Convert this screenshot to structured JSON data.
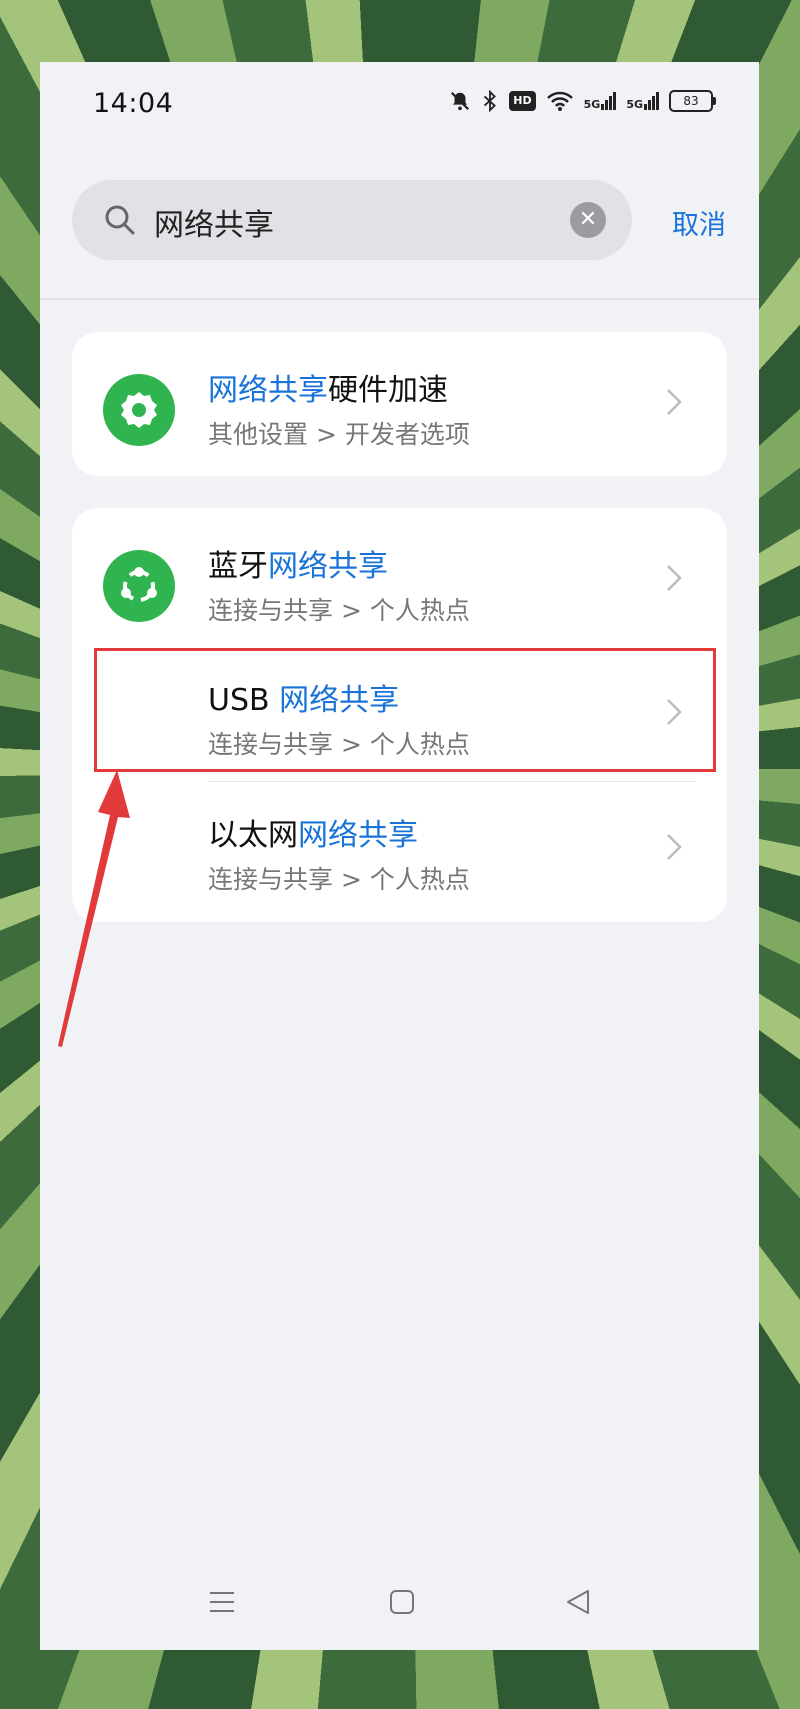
{
  "status_bar": {
    "time": "14:04",
    "hd_label": "HD",
    "signal1_label": "5G",
    "signal2_label": "5G",
    "battery_level": "83",
    "icons": [
      "bell-off-icon",
      "bluetooth-icon",
      "hd-icon",
      "wifi-icon",
      "signal-5g-icon",
      "signal-5g-icon",
      "battery-icon"
    ]
  },
  "search": {
    "query": "网络共享",
    "cancel_label": "取消"
  },
  "results": {
    "group1": [
      {
        "title_highlight": "网络共享",
        "title_rest": "硬件加速",
        "path": "其他设置 > 开发者选项",
        "icon": "settings-gear-icon"
      }
    ],
    "group2": [
      {
        "title_prefix": "蓝牙",
        "title_highlight": "网络共享",
        "path": "连接与共享 > 个人热点",
        "icon": "share-icon"
      },
      {
        "title_prefix": "USB ",
        "title_highlight": "网络共享",
        "path": "连接与共享 > 个人热点"
      },
      {
        "title_prefix": "以太网",
        "title_highlight": "网络共享",
        "path": "连接与共享 > 个人热点"
      }
    ]
  },
  "colors": {
    "accent": "#1a73d8",
    "icon_green": "#2fb44f",
    "annotation_red": "#e23a3a"
  }
}
